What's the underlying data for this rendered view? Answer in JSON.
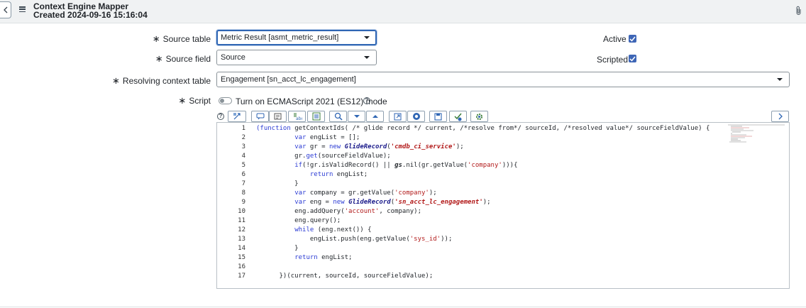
{
  "header": {
    "title": "Context Engine Mapper",
    "subtitle": "Created 2024-09-16 15:16:04"
  },
  "form": {
    "required_mark": "∗",
    "source_table": {
      "label": "Source table",
      "value": "Metric Result [asmt_metric_result]"
    },
    "source_field": {
      "label": "Source field",
      "value": "Source"
    },
    "resolving_context_table": {
      "label": "Resolving context table",
      "value": "Engagement [sn_acct_lc_engagement]"
    },
    "active": {
      "label": "Active",
      "checked": true
    },
    "scripted": {
      "label": "Scripted",
      "checked": true
    },
    "script": {
      "label": "Script",
      "toggle_label": "Turn on ECMAScript 2021 (ES12) mode",
      "help": "?"
    }
  },
  "toolbar": {
    "buttons": [
      "help-icon",
      "format-icon",
      "comment-icon",
      "align-icon",
      "toggle-comment-icon",
      "replace-icon",
      "search-icon",
      "next-icon",
      "previous-icon",
      "open-icon",
      "script-debugger-icon",
      "save-icon",
      "check-icon",
      "settings-icon"
    ],
    "expand_label": ">"
  },
  "editor": {
    "line_numbers": [
      "1",
      "2",
      "3",
      "4",
      "5",
      "6",
      "7",
      "8",
      "9",
      "10",
      "11",
      "12",
      "13",
      "14",
      "15",
      "16",
      "17"
    ]
  },
  "colors": {
    "accent": "#3e66b6",
    "header_bg": "#f0f2f3",
    "string": "#b21a1a",
    "keyword": "#2b3bd4"
  }
}
